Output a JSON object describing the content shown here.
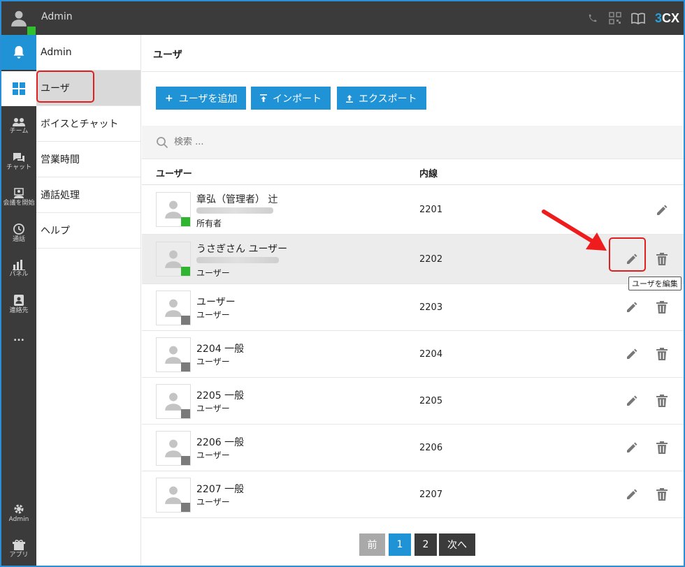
{
  "topbar": {
    "title": "Admin",
    "brand_num": "3",
    "brand_txt": "CX"
  },
  "rail": {
    "team": "チーム",
    "chat": "チャット",
    "meeting": "会議を開始",
    "calls": "通話",
    "panel": "パネル",
    "contacts": "連絡先",
    "more": "...",
    "admin": "Admin",
    "apps": "アプリ"
  },
  "subnav": {
    "items": [
      {
        "label": "Admin"
      },
      {
        "label": "ユーザ"
      },
      {
        "label": "ボイスとチャット"
      },
      {
        "label": "営業時間"
      },
      {
        "label": "通話処理"
      },
      {
        "label": "ヘルプ"
      }
    ]
  },
  "main": {
    "title": "ユーザ",
    "buttons": {
      "add": "ユーザを追加",
      "import": "インポート",
      "export": "エクスポート"
    },
    "search_placeholder": "検索 ...",
    "columns": {
      "user": "ユーザー",
      "ext": "内線"
    },
    "rows": [
      {
        "name": "章弘（管理者） 辻",
        "role": "所有者",
        "ext": "2201"
      },
      {
        "name": "うさぎさん ユーザー",
        "role": "ユーザー",
        "ext": "2202"
      },
      {
        "name": "ユーザー",
        "role": "ユーザー",
        "ext": "2203"
      },
      {
        "name": "2204 一般",
        "role": "ユーザー",
        "ext": "2204"
      },
      {
        "name": "2205 一般",
        "role": "ユーザー",
        "ext": "2205"
      },
      {
        "name": "2206 一般",
        "role": "ユーザー",
        "ext": "2206"
      },
      {
        "name": "2207 一般",
        "role": "ユーザー",
        "ext": "2207"
      }
    ],
    "tooltip": "ユーザを編集",
    "pager": {
      "prev": "前",
      "p1": "1",
      "p2": "2",
      "next": "次へ"
    }
  },
  "colors": {
    "accent": "#1f93d6",
    "dark": "#3b3b3b",
    "online": "#2fb52f",
    "highlight": "#e02020"
  }
}
